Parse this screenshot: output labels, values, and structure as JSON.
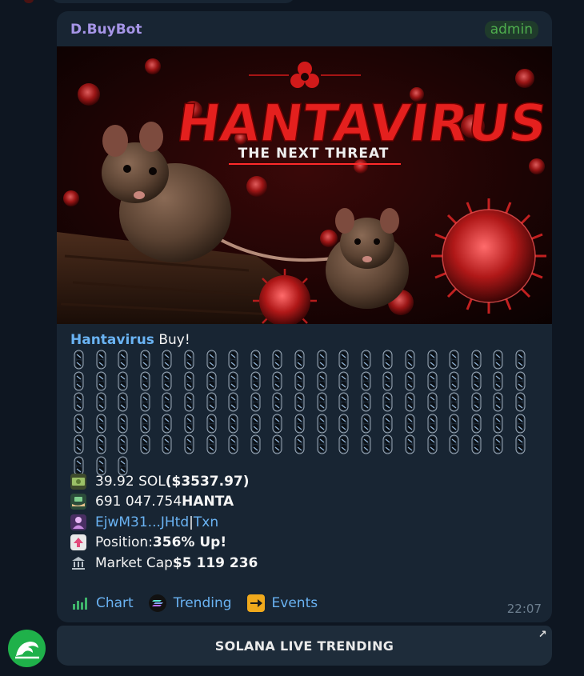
{
  "message": {
    "sender": "D.BuyBot",
    "badge": "admin",
    "banner": {
      "title": "HANTAVIRUS",
      "subtitle": "THE NEXT THREAT"
    },
    "token_link": "Hantavirus",
    "buy_label": " Buy!",
    "pill_count": 108,
    "stats": {
      "sol_amount": "39.92 SOL ",
      "sol_usd": "($3537.97)",
      "token_amount": "691 047.754 ",
      "token_symbol": "HANTA",
      "wallet": "EjwM31...JHtd",
      "separator": " | ",
      "txn": "Txn",
      "position_label": "Position: ",
      "position_value": "356% Up!",
      "mcap_label": "Market Cap ",
      "mcap_value": "$5 119 236"
    },
    "links": {
      "chart": "Chart",
      "trending": "Trending",
      "events": "Events"
    },
    "time": "22:07"
  },
  "keyboard": {
    "button_label": "SOLANA LIVE TRENDING",
    "arrow": "↗"
  },
  "colors": {
    "background": "#0e1621",
    "bubble": "#182533",
    "link": "#6ab3f3",
    "sender": "#a695e7",
    "admin": "#4fae4e",
    "avatar": "#1fb14a"
  }
}
